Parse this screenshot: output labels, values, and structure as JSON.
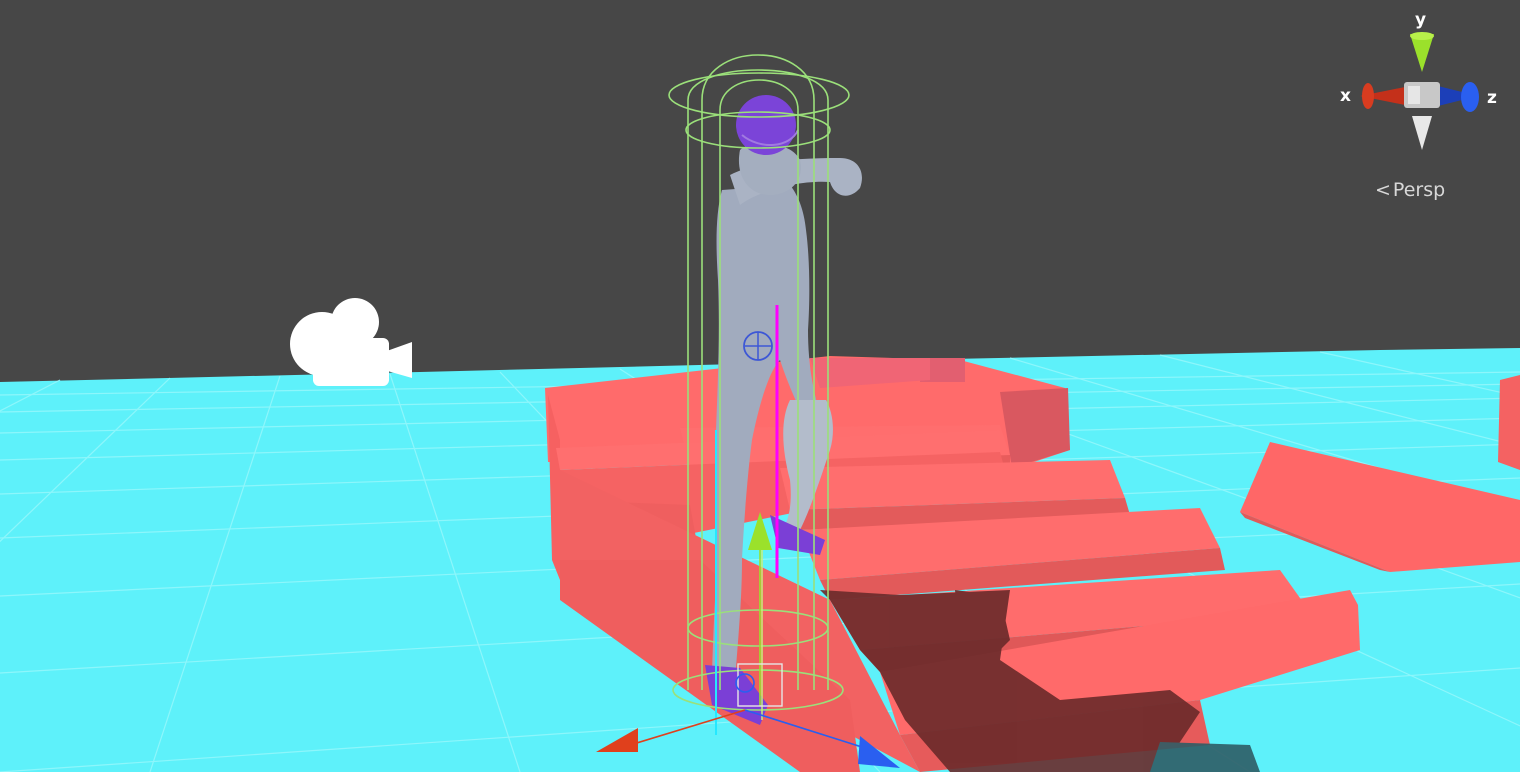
{
  "scene_view": {
    "colors": {
      "background": "#474747",
      "ground": "#5ef1fa",
      "grid_line": "#8ef6fb",
      "stairs": "#ff6464",
      "character": "#9ea9bd",
      "character_mesh_highlight": "#7b3fd6",
      "collider_gizmo": "#9be07a",
      "axis_x": "#e0401c",
      "axis_y": "#9be12b",
      "axis_z": "#2a5ff0"
    },
    "icons": {
      "scene_camera": "camera-gizmo-icon",
      "view_gizmo": "orientation-gizmo-icon",
      "projection_chevron": "chevron-left-icon"
    }
  },
  "orientation_gizmo": {
    "x_label": "x",
    "y_label": "y",
    "z_label": "z",
    "projection_label": "Persp",
    "projection_chevron": "<"
  }
}
